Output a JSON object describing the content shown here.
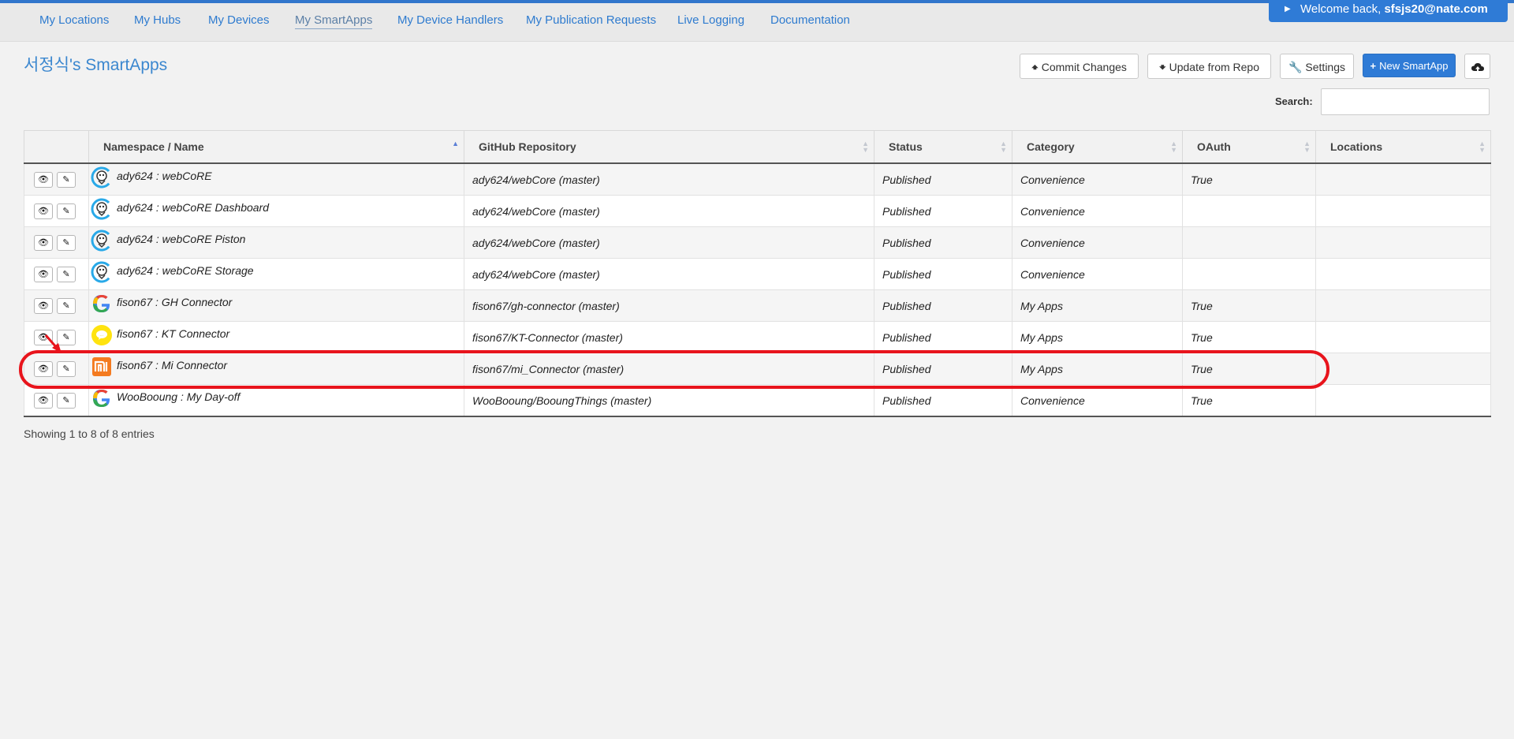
{
  "nav": {
    "items": [
      "My Locations",
      "My Hubs",
      "My Devices",
      "My SmartApps",
      "My Device Handlers",
      "My Publication Requests",
      "Live Logging",
      "Documentation"
    ],
    "active": "My SmartApps",
    "welcome_prefix": "Welcome back,",
    "welcome_user": "sfsjs20@nate.com"
  },
  "page": {
    "title": "서정식's SmartApps"
  },
  "toolbar": {
    "commit": "Commit Changes",
    "update": "Update from Repo",
    "settings": "Settings",
    "new_smartapp": "New SmartApp"
  },
  "search": {
    "label": "Search:",
    "value": ""
  },
  "table": {
    "columns": [
      "Namespace / Name",
      "GitHub Repository",
      "Status",
      "Category",
      "OAuth",
      "Locations"
    ],
    "rows": [
      {
        "name": "ady624 : webCoRE",
        "repo": "ady624/webCore (master)",
        "status": "Published",
        "category": "Convenience",
        "oauth": "True",
        "locations": "",
        "icon": "webcore-logo-icon"
      },
      {
        "name": "ady624 : webCoRE Dashboard",
        "repo": "ady624/webCore (master)",
        "status": "Published",
        "category": "Convenience",
        "oauth": "",
        "locations": "",
        "icon": "webcore-logo-icon"
      },
      {
        "name": "ady624 : webCoRE Piston",
        "repo": "ady624/webCore (master)",
        "status": "Published",
        "category": "Convenience",
        "oauth": "",
        "locations": "",
        "icon": "webcore-logo-icon"
      },
      {
        "name": "ady624 : webCoRE Storage",
        "repo": "ady624/webCore (master)",
        "status": "Published",
        "category": "Convenience",
        "oauth": "",
        "locations": "",
        "icon": "webcore-logo-icon"
      },
      {
        "name": "fison67 : GH Connector",
        "repo": "fison67/gh-connector (master)",
        "status": "Published",
        "category": "My Apps",
        "oauth": "True",
        "locations": "",
        "icon": "google-logo-icon"
      },
      {
        "name": "fison67 : KT Connector",
        "repo": "fison67/KT-Connector (master)",
        "status": "Published",
        "category": "My Apps",
        "oauth": "True",
        "locations": "",
        "icon": "chat-bubble-logo-icon"
      },
      {
        "name": "fison67 : Mi Connector",
        "repo": "fison67/mi_Connector (master)",
        "status": "Published",
        "category": "My Apps",
        "oauth": "True",
        "locations": "",
        "icon": "xiaomi-logo-icon"
      },
      {
        "name": "WooBooung : My Day-off",
        "repo": "WooBooung/BooungThings (master)",
        "status": "Published",
        "category": "Convenience",
        "oauth": "True",
        "locations": "",
        "icon": "google-logo-icon"
      }
    ]
  },
  "footer": {
    "info": "Showing 1 to 8 of 8 entries"
  },
  "colors": {
    "accent": "#2f7bd6",
    "highlight_annotation": "#e8141c"
  }
}
